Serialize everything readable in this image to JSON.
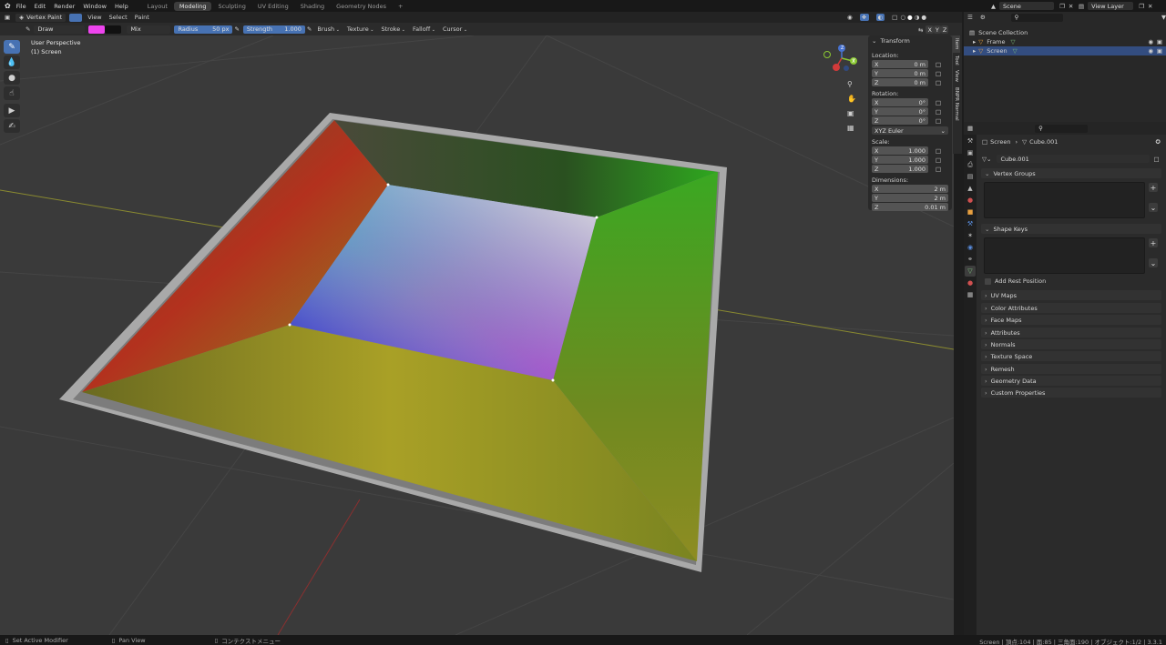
{
  "topbar": {
    "menus": [
      "File",
      "Edit",
      "Render",
      "Window",
      "Help"
    ],
    "workspaces": [
      "Layout",
      "Modeling",
      "Sculpting",
      "UV Editing",
      "Shading",
      "Geometry Nodes"
    ],
    "active_workspace": "Modeling",
    "add_tab": "+",
    "scene_name": "Scene",
    "view_layer_name": "View Layer"
  },
  "viewport_header": {
    "mode": "Vertex Paint",
    "menus": [
      "View",
      "Select",
      "Paint"
    ]
  },
  "tool_options": {
    "brush_name": "Draw",
    "color_primary": "#ee44ee",
    "color_secondary": "#111111",
    "blend": "Mix",
    "radius_label": "Radius",
    "radius_value": "50 px",
    "strength_label": "Strength",
    "strength_value": "1.000",
    "strength_fraction": 1.0,
    "dropdowns": [
      "Brush",
      "Texture",
      "Stroke",
      "Falloff",
      "Cursor"
    ],
    "axes": [
      "X",
      "Y",
      "Z"
    ]
  },
  "viewport": {
    "perspective": "User Perspective",
    "object": "(1) Screen",
    "gizmo_axes": [
      "X",
      "Y",
      "Z"
    ]
  },
  "npanel": {
    "title": "Transform",
    "location_label": "Location:",
    "location": [
      {
        "axis": "X",
        "value": "0 m"
      },
      {
        "axis": "Y",
        "value": "0 m"
      },
      {
        "axis": "Z",
        "value": "0 m"
      }
    ],
    "rotation_label": "Rotation:",
    "rotation": [
      {
        "axis": "X",
        "value": "0°"
      },
      {
        "axis": "Y",
        "value": "0°"
      },
      {
        "axis": "Z",
        "value": "0°"
      }
    ],
    "rotation_mode": "XYZ Euler",
    "scale_label": "Scale:",
    "scale": [
      {
        "axis": "X",
        "value": "1.000"
      },
      {
        "axis": "Y",
        "value": "1.000"
      },
      {
        "axis": "Z",
        "value": "1.000"
      }
    ],
    "dimensions_label": "Dimensions:",
    "dimensions": [
      {
        "axis": "X",
        "value": "2 m"
      },
      {
        "axis": "Y",
        "value": "2 m"
      },
      {
        "axis": "Z",
        "value": "0.01 m"
      }
    ],
    "tabs": [
      "Item",
      "Tool",
      "View",
      "BNPR Normal"
    ]
  },
  "outliner": {
    "root": "Scene Collection",
    "items": [
      {
        "name": "Frame",
        "selected": false
      },
      {
        "name": "Screen",
        "selected": true
      }
    ]
  },
  "properties": {
    "breadcrumb_object": "Screen",
    "breadcrumb_mesh": "Cube.001",
    "mesh_name": "Cube.001",
    "vertex_groups_title": "Vertex Groups",
    "shape_keys_title": "Shape Keys",
    "add_rest_position": "Add Rest Position",
    "sections": [
      "UV Maps",
      "Color Attributes",
      "Face Maps",
      "Attributes",
      "Normals",
      "Texture Space",
      "Remesh",
      "Geometry Data",
      "Custom Properties"
    ]
  },
  "statusbar": {
    "left1": "Set Active Modifier",
    "left2": "Pan View",
    "left3": "コンテクストメニュー",
    "right": "Screen | 頂点:104 | 面:85 | 三角面:190 | オブジェクト:1/2 | 3.3.1"
  }
}
